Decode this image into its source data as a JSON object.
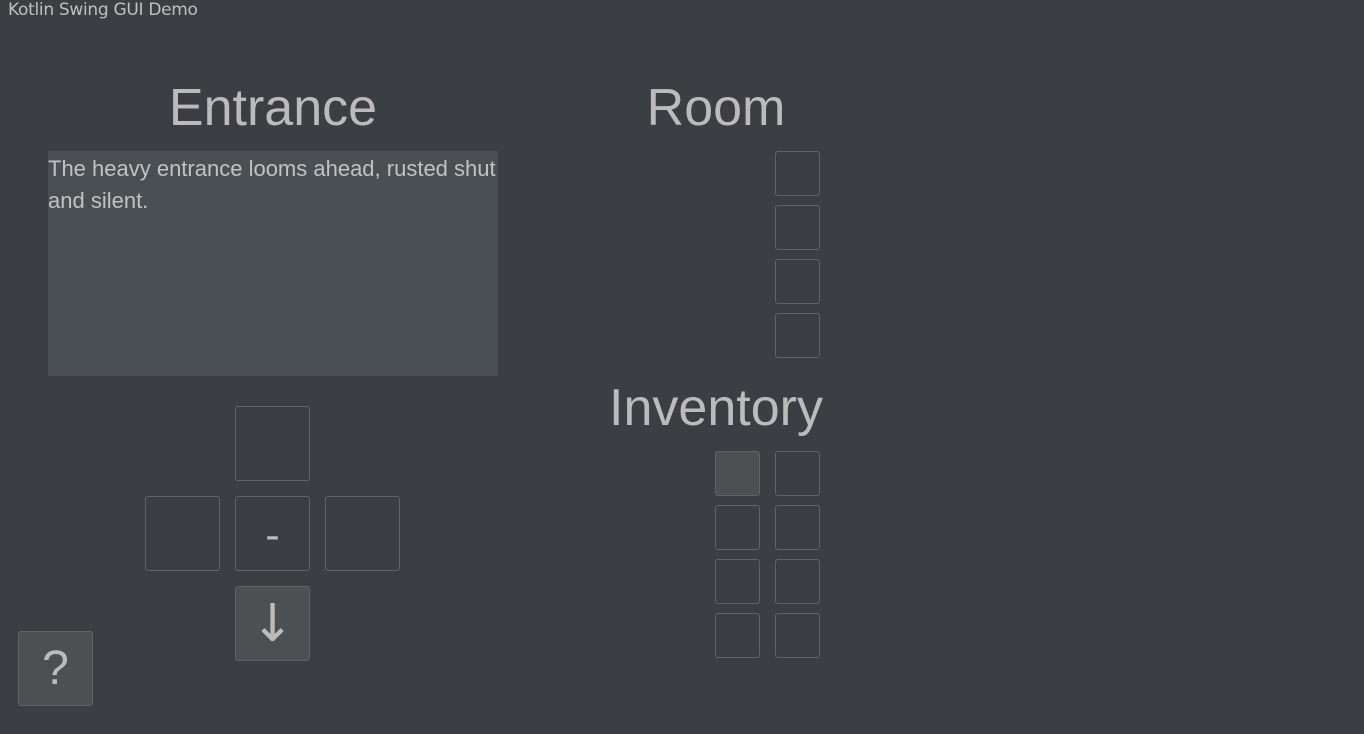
{
  "window": {
    "title": "Kotlin Swing GUI Demo"
  },
  "location": {
    "title": "Entrance",
    "description": "The heavy entrance looms ahead, rusted shut and silent."
  },
  "navigation": {
    "north_label": "",
    "west_label": "",
    "center_label": "-",
    "east_label": "",
    "south_label": "↓"
  },
  "help": {
    "label": "?"
  },
  "room": {
    "title": "Room",
    "slots": [
      "",
      "",
      "",
      ""
    ]
  },
  "inventory": {
    "title": "Inventory",
    "slots": [
      "",
      "",
      "",
      "",
      "",
      "",
      "",
      ""
    ]
  }
}
